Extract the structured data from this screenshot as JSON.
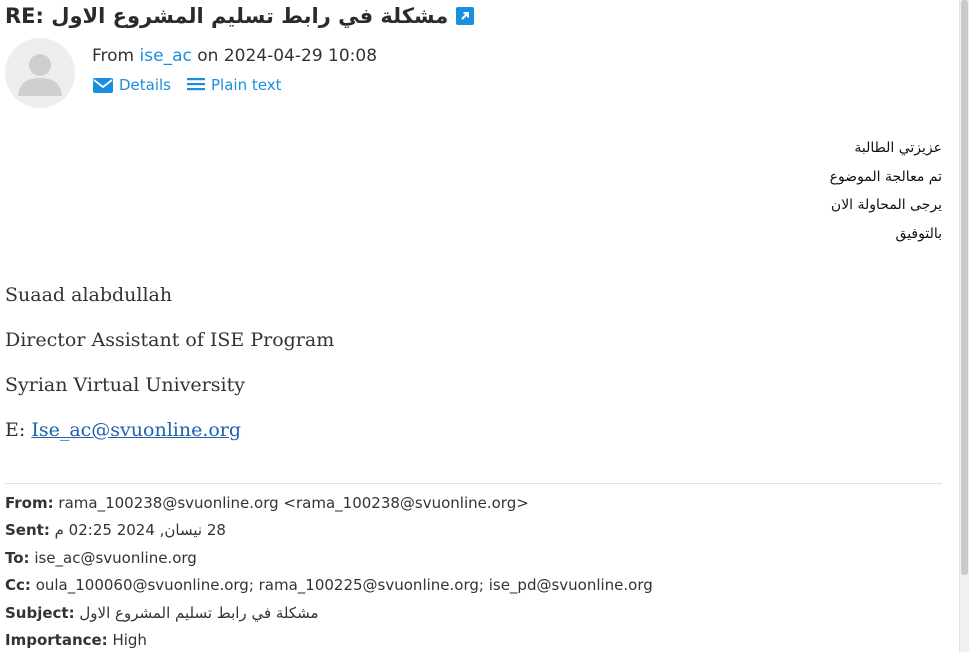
{
  "message": {
    "subject": "RE: مشكلة في رابط تسليم المشروع الاول",
    "from_prefix": "From",
    "sender": "ise_ac",
    "date_prefix": "on",
    "datetime": "2024-04-29 10:08",
    "links": {
      "details": "Details",
      "plain_text": "Plain text"
    }
  },
  "body": {
    "arabic_lines": [
      "عزيزتي الطالبة",
      "تم معالجة الموضوع",
      "يرجى المحاولة الان",
      "بالتوفيق"
    ],
    "signature": {
      "name": "Suaad alabdullah",
      "title": "Director Assistant of ISE Program",
      "org": "Syrian Virtual University",
      "email_label": "E:",
      "email": "Ise_ac@svuonline.org"
    }
  },
  "quoted_header": {
    "from_label": "From:",
    "from_value": "rama_100238@svuonline.org <rama_100238@svuonline.org>",
    "sent_label": "Sent:",
    "sent_value": "28 نيسان, 2024 02:25 م",
    "to_label": "To:",
    "to_value": "ise_ac@svuonline.org",
    "cc_label": "Cc:",
    "cc_value": "oula_100060@svuonline.org; rama_100225@svuonline.org; ise_pd@svuonline.org",
    "subject_label": "Subject:",
    "subject_value": "مشكلة في رابط تسليم المشروع الاول",
    "importance_label": "Importance:",
    "importance_value": "High"
  },
  "icons": {
    "popout": "external-link-icon",
    "details": "envelope-icon",
    "plain_text": "lines-icon",
    "avatar": "user-placeholder"
  },
  "colors": {
    "link": "#1a8fde",
    "signature_link": "#1f5fae",
    "avatar_bg": "#eeeeee"
  }
}
